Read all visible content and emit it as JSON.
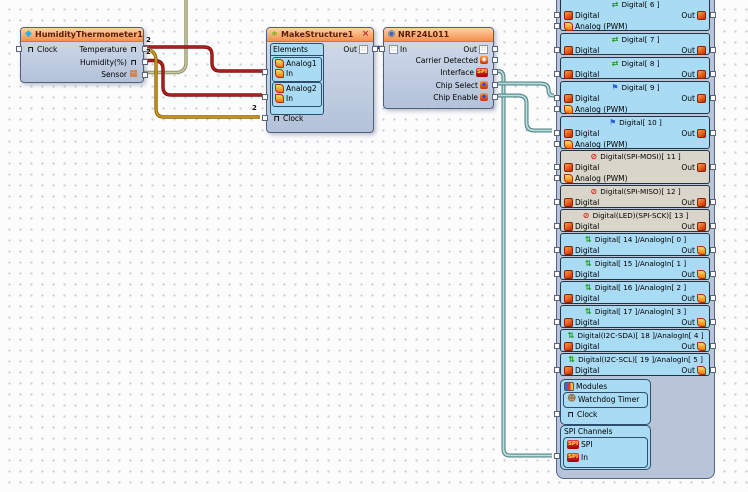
{
  "components": {
    "humidity_thermometer": {
      "title": "HumidityThermometer1",
      "title_icon": "thermometer-icon",
      "left_pins": [
        {
          "label": "Clock",
          "icon": "pulse-icon"
        }
      ],
      "right_pins": [
        {
          "label": "Temperature",
          "icon": "pulse-icon",
          "badge": "2"
        },
        {
          "label": "Humidity(%)",
          "icon": "pulse-icon",
          "badge": "2"
        },
        {
          "label": "Sensor",
          "icon": "sensor-icon"
        }
      ]
    },
    "make_structure": {
      "title": "MakeStructure1",
      "title_icon": "sparkle-icon",
      "title_icon_right": "tools-icon",
      "out_pin": {
        "label": "Out",
        "icon": "structure-icon"
      },
      "elements": {
        "header": "Elements",
        "groups": [
          {
            "rows": [
              {
                "label": "Analog1",
                "icon": "analog-icon"
              },
              {
                "label": "In",
                "icon": "analog-icon",
                "pin": true
              }
            ]
          },
          {
            "rows": [
              {
                "label": "Analog2",
                "icon": "analog-icon"
              },
              {
                "label": "In",
                "icon": "analog-icon",
                "pin": true
              }
            ]
          }
        ]
      },
      "clock_pin": {
        "label": "Clock",
        "icon": "pulse-icon",
        "badge": "2"
      }
    },
    "nrf": {
      "title": "NRF24L011",
      "title_icon": "radio-icon",
      "left_pins": [
        {
          "label": "In",
          "icon": "structure-icon"
        }
      ],
      "right_pins": [
        {
          "label": "Out",
          "icon": "structure-icon"
        },
        {
          "label": "Carrier Detected",
          "icon": "carrier-icon"
        },
        {
          "label": "Interface",
          "icon": "spi-icon"
        },
        {
          "label": "Chip Select",
          "icon": "chip-icon"
        },
        {
          "label": "Chip Enable",
          "icon": "chip-icon"
        }
      ]
    }
  },
  "board": {
    "boxes": [
      {
        "header": "Digital[ 6 ]",
        "header_icon": "digital-pair-icon",
        "style": "blue",
        "rows": [
          {
            "label": "Digital",
            "icon": "digital-icon",
            "out": "Out",
            "out_icon": "digital-out-icon"
          },
          {
            "label": "Analog (PWM)",
            "icon": "analog-icon"
          }
        ]
      },
      {
        "header": "Digital[ 7 ]",
        "header_icon": "digital-pair-icon",
        "style": "blue",
        "rows": [
          {
            "label": "Digital",
            "icon": "digital-icon",
            "out": "Out",
            "out_icon": "digital-out-icon"
          }
        ]
      },
      {
        "header": "Digital[ 8 ]",
        "header_icon": "digital-pair-icon",
        "style": "blue",
        "rows": [
          {
            "label": "Digital",
            "icon": "digital-icon",
            "out": "Out",
            "out_icon": "digital-out-icon"
          }
        ]
      },
      {
        "header": "Digital[ 9 ]",
        "header_icon": "digital-flag-icon",
        "style": "blue",
        "rows": [
          {
            "label": "Digital",
            "icon": "digital-icon",
            "out": "Out",
            "out_icon": "digital-out-icon"
          },
          {
            "label": "Analog (PWM)",
            "icon": "analog-icon"
          }
        ]
      },
      {
        "header": "Digital[ 10 ]",
        "header_icon": "digital-flag-icon",
        "style": "blue",
        "rows": [
          {
            "label": "Digital",
            "icon": "digital-icon",
            "out": "Out",
            "out_icon": "digital-out-icon"
          },
          {
            "label": "Analog (PWM)",
            "icon": "analog-icon"
          }
        ]
      },
      {
        "header": "Digital(SPI-MOSI)[ 11 ]",
        "header_icon": "spi-blocked-icon",
        "style": "gray",
        "rows": [
          {
            "label": "Digital",
            "icon": "digital-icon",
            "out": "Out",
            "out_icon": "digital-out-icon"
          },
          {
            "label": "Analog (PWM)",
            "icon": "analog-icon"
          }
        ]
      },
      {
        "header": "Digital(SPI-MISO)[ 12 ]",
        "header_icon": "spi-blocked-icon",
        "style": "gray",
        "rows": [
          {
            "label": "Digital",
            "icon": "digital-icon",
            "out": "Out",
            "out_icon": "digital-out-icon"
          }
        ]
      },
      {
        "header": "Digital(LED)(SPI-SCK)[ 13 ]",
        "header_icon": "spi-blocked-icon",
        "style": "gray",
        "rows": [
          {
            "label": "Digital",
            "icon": "digital-icon",
            "out": "Out",
            "out_icon": "digital-out-icon"
          }
        ]
      },
      {
        "header": "Digital[ 14 ]/AnalogIn[ 0 ]",
        "header_icon": "analog-digital-icon",
        "style": "blue",
        "rows": [
          {
            "label": "Digital",
            "icon": "digital-icon",
            "out": "Out",
            "out_icon": "analog-out-icon"
          }
        ]
      },
      {
        "header": "Digital[ 15 ]/AnalogIn[ 1 ]",
        "header_icon": "analog-digital-icon",
        "style": "blue",
        "rows": [
          {
            "label": "Digital",
            "icon": "digital-icon",
            "out": "Out",
            "out_icon": "analog-out-icon"
          }
        ]
      },
      {
        "header": "Digital[ 16 ]/AnalogIn[ 2 ]",
        "header_icon": "analog-digital-icon",
        "style": "blue",
        "rows": [
          {
            "label": "Digital",
            "icon": "digital-icon",
            "out": "Out",
            "out_icon": "analog-out-icon"
          }
        ]
      },
      {
        "header": "Digital[ 17 ]/AnalogIn[ 3 ]",
        "header_icon": "analog-digital-icon",
        "style": "blue",
        "rows": [
          {
            "label": "Digital",
            "icon": "digital-icon",
            "out": "Out",
            "out_icon": "analog-out-icon"
          }
        ]
      },
      {
        "header": "Digital(I2C-SDA)[ 18 ]/AnalogIn[ 4 ]",
        "header_icon": "analog-digital-icon",
        "style": "blue",
        "rows": [
          {
            "label": "Digital",
            "icon": "digital-icon",
            "out": "Out",
            "out_icon": "analog-out-icon"
          }
        ]
      },
      {
        "header": "Digital(I2C-SCL)[ 19 ]/AnalogIn[ 5 ]",
        "header_icon": "analog-digital-icon",
        "style": "blue",
        "rows": [
          {
            "label": "Digital",
            "icon": "digital-icon",
            "out": "Out",
            "out_icon": "analog-out-icon"
          }
        ]
      }
    ],
    "modules": {
      "title": "Modules",
      "icon": "modules-icon",
      "watchdog": {
        "label": "Watchdog Timer",
        "icon": "watchdog-icon"
      },
      "clock": {
        "label": "Clock",
        "icon": "pulse-icon"
      }
    },
    "spi_channels": {
      "title": "SPI Channels",
      "items": [
        {
          "label": "SPI",
          "icon": "spi-icon"
        },
        {
          "label": "In",
          "icon": "spi-icon",
          "pin": true
        }
      ]
    }
  },
  "icon_labels": {
    "spi": "SPI"
  },
  "wires": [
    {
      "id": "sensor-link",
      "color": "olive",
      "from": "HumidityThermometer1.Sensor",
      "to": "off-screen-top"
    },
    {
      "id": "temperature-to-analog1",
      "color": "red",
      "from": "HumidityThermometer1.Temperature",
      "to": "MakeStructure1.Analog1.In"
    },
    {
      "id": "humidity-to-analog2",
      "color": "red",
      "from": "HumidityThermometer1.Humidity(%)",
      "to": "MakeStructure1.Analog2.In"
    },
    {
      "id": "temperature-to-clock",
      "color": "gold",
      "from": "HumidityThermometer1.Temperature",
      "to": "MakeStructure1.Clock"
    },
    {
      "id": "structure-out-to-nrf-in",
      "color": "blue",
      "from": "MakeStructure1.Out",
      "to": "NRF24L011.In"
    },
    {
      "id": "interface-to-spi-in",
      "color": "teal",
      "from": "NRF24L011.Interface",
      "to": "SPI.In"
    },
    {
      "id": "chip-select-to-digital9",
      "color": "teal",
      "from": "NRF24L011.Chip Select",
      "to": "Digital[ 9 ].Digital"
    },
    {
      "id": "chip-enable-to-digital10",
      "color": "teal",
      "from": "NRF24L011.Chip Enable",
      "to": "Digital[ 10 ].Digital"
    }
  ],
  "colors": {
    "title_bar": "#f2914f",
    "component_body": "#b9c6de",
    "board_blue": "#a9dbf4",
    "board_gray": "#d9d5ca",
    "wire_red": [
      "#7e100e",
      "#b62420"
    ],
    "wire_gold": [
      "#8a6408",
      "#d3a01e"
    ],
    "wire_olive": [
      "#8f8f68",
      "#cbcba4"
    ],
    "wire_blue": [
      "#141a9e",
      "#3a48d8"
    ],
    "wire_teal": [
      "#4e8585",
      "#bddcdc"
    ]
  }
}
